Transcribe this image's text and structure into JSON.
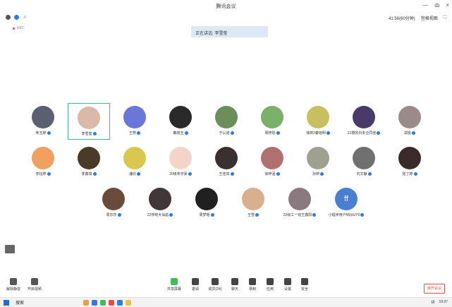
{
  "window": {
    "title": "腾讯会议",
    "min": "—",
    "max": "ȸ",
    "close": "×"
  },
  "topbar": {
    "network": "41:56(60分钟)",
    "view": "宫格视图",
    "fullscreen": "⛶"
  },
  "recording": "REC",
  "speaking": "正在讲话: 李雪莹",
  "participants": [
    {
      "name": "朱玉婷",
      "color": "#5a6070",
      "initial": ""
    },
    {
      "name": "李雪莹",
      "color": "#d9b9a8",
      "initial": "",
      "selected": true
    },
    {
      "name": "王燕",
      "color": "#6a76d8",
      "initial": ""
    },
    {
      "name": "戴晓玉",
      "color": "#2a2a2a",
      "initial": ""
    },
    {
      "name": "于以诺",
      "color": "#6b8f5a",
      "initial": ""
    },
    {
      "name": "周梓彤",
      "color": "#7bb06a",
      "initial": ""
    },
    {
      "name": "徐婷2秦瑶明",
      "color": "#c8c060",
      "initial": ""
    },
    {
      "name": "21楼的日本仝同佳",
      "color": "#4a3a6a",
      "initial": ""
    },
    {
      "name": "郑雯",
      "color": "#9a8a8a",
      "initial": ""
    },
    {
      "name": "李钰婷",
      "color": "#f0a060",
      "initial": ""
    },
    {
      "name": "李鑫琪",
      "color": "#4a3a2a",
      "initial": ""
    },
    {
      "name": "潘欣",
      "color": "#d8c850",
      "initial": ""
    },
    {
      "name": "20级朱宇豪",
      "color": "#f2d4c8",
      "initial": ""
    },
    {
      "name": "王佳如",
      "color": "#3a3030",
      "initial": ""
    },
    {
      "name": "徐梓涵",
      "color": "#b07070",
      "initial": ""
    },
    {
      "name": "孙婷",
      "color": "#a0a090",
      "initial": ""
    },
    {
      "name": "刘文静",
      "color": "#707070",
      "initial": ""
    },
    {
      "name": "陆丁婷",
      "color": "#3a2a2a",
      "initial": ""
    },
    {
      "name": "周莎莎",
      "color": "#6a4a3a",
      "initial": ""
    },
    {
      "name": "22传统大仙姑",
      "color": "#403838",
      "initial": ""
    },
    {
      "name": "周梦瑶",
      "color": "#202020",
      "initial": ""
    },
    {
      "name": "王雪",
      "color": "#d8b090",
      "initial": ""
    },
    {
      "name": "22级工一班王鑫阳",
      "color": "#8a7a80",
      "initial": ""
    },
    {
      "name": "小程序用户fWytUY6",
      "color": "#4a7ed0",
      "initial": "ff"
    }
  ],
  "toolbar": {
    "left": [
      {
        "label": "解除静音"
      },
      {
        "label": "开启视频"
      }
    ],
    "center": [
      {
        "label": "共享屏幕"
      },
      {
        "label": "邀请"
      },
      {
        "label": "成员(24)"
      },
      {
        "label": "聊天"
      },
      {
        "label": "录制"
      },
      {
        "label": "应用"
      },
      {
        "label": "设置"
      },
      {
        "label": "安全"
      }
    ],
    "leave": "离开会议"
  },
  "taskbar": {
    "search": "搜索",
    "time": "19:37",
    "ime": "拼"
  }
}
